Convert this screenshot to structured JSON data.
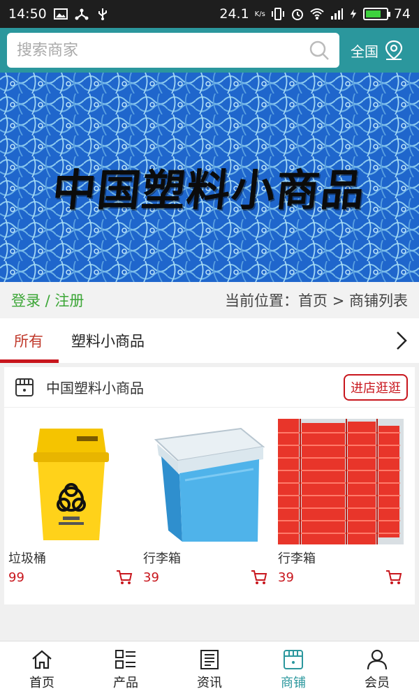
{
  "status_bar": {
    "time": "14:50",
    "network_speed": "24.1",
    "speed_unit": "K/s",
    "battery": "74",
    "battery_level": 0.74,
    "left_icons": [
      "image-icon",
      "share-icon",
      "usb-icon"
    ],
    "right_icons": [
      "vibrate-icon",
      "alarm-icon",
      "wifi-icon",
      "signal-icon",
      "charging-icon",
      "battery-icon"
    ]
  },
  "header": {
    "search_placeholder": "搜索商家",
    "region_label": "全国",
    "accent_color": "#2b979d"
  },
  "banner": {
    "title": "中国塑料小商品"
  },
  "location_bar": {
    "login_register": "登录 / 注册",
    "location_text": "当前位置：首页 > 商铺列表"
  },
  "tabs": [
    {
      "label": "所有",
      "active": true
    },
    {
      "label": "塑料小商品",
      "active": false
    }
  ],
  "store": {
    "name": "中国塑料小商品",
    "visit_button": "进店逛逛",
    "products": [
      {
        "name": "垃圾桶",
        "price": "99",
        "image": "yellow-trash-bin"
      },
      {
        "name": "行李箱",
        "price": "39",
        "image": "blue-storage-box"
      },
      {
        "name": "行李箱",
        "price": "39",
        "image": "red-crates"
      }
    ]
  },
  "bottom_nav": [
    {
      "label": "首页",
      "icon": "home-icon",
      "active": false
    },
    {
      "label": "产品",
      "icon": "list-icon",
      "active": false
    },
    {
      "label": "资讯",
      "icon": "news-icon",
      "active": false
    },
    {
      "label": "商铺",
      "icon": "store-icon",
      "active": true
    },
    {
      "label": "会员",
      "icon": "user-icon",
      "active": false
    }
  ],
  "colors": {
    "accent": "#2b979d",
    "price_red": "#c8161d",
    "login_green": "#3ca637"
  }
}
